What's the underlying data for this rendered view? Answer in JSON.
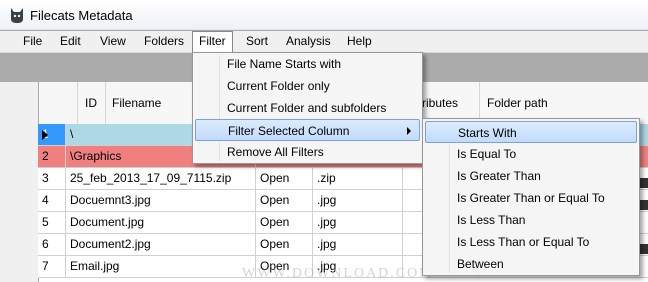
{
  "window": {
    "title": "Filecats Metadata"
  },
  "menubar": [
    "File",
    "Edit",
    "View",
    "Folders",
    "Filter",
    "Sort",
    "Analysis",
    "Help"
  ],
  "grid": {
    "headers": {
      "id": "ID",
      "filename": "Filename",
      "attributes": "ributes",
      "folder_path": "Folder path"
    },
    "rows": [
      {
        "id": "1",
        "filename": "\\",
        "attr": "",
        "ext": ""
      },
      {
        "id": "2",
        "filename": "\\Graphics",
        "attr": "",
        "ext": ""
      },
      {
        "id": "3",
        "filename": "25_feb_2013_17_09_7115.zip",
        "attr": "Open",
        "ext": ".zip"
      },
      {
        "id": "4",
        "filename": "Docuemnt3.jpg",
        "attr": "Open",
        "ext": ".jpg"
      },
      {
        "id": "5",
        "filename": "Document.jpg",
        "attr": "Open",
        "ext": ".jpg"
      },
      {
        "id": "6",
        "filename": "Document2.jpg",
        "attr": "Open",
        "ext": ".jpg"
      },
      {
        "id": "7",
        "filename": "Email.jpg",
        "attr": "Open",
        "ext": ".jpg"
      }
    ]
  },
  "filter_menu": [
    "File Name Starts with",
    "Current Folder only",
    "Current Folder and subfolders",
    "Filter Selected Column",
    "Remove All Filters"
  ],
  "filter_submenu": [
    "Starts With",
    "Is Equal To",
    "Is Greater Than",
    "Is Greater Than or Equal To",
    "Is Less Than",
    "Is Less Than or Equal To",
    "Between"
  ],
  "watermark": "WWW.DOWNLOAD.COM",
  "colors": {
    "row1_bg": "#add8e6",
    "row1_id_bg": "#3399ff",
    "row2_bg": "#f08080",
    "highlight": "#c1dbfc"
  }
}
